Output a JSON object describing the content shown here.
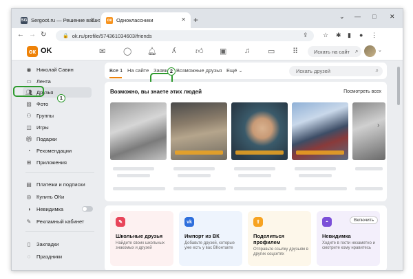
{
  "browser": {
    "tabs": [
      {
        "favicon": "SG",
        "title": "Sergoot.ru — Решение ваших п"
      },
      {
        "favicon": "ok",
        "title": "Одноклассники"
      }
    ],
    "new_tab": "+",
    "window_controls": {
      "minimize": "—",
      "maximize": "□",
      "close": "✕"
    },
    "url": "ok.ru/profile/574361034603/friends"
  },
  "header": {
    "logo_text": "OK",
    "search_placeholder": "Искать на сайт"
  },
  "sidebar": {
    "user_name": "Николай Савин",
    "items": [
      {
        "label": "Лента",
        "icon": "feed-icon"
      },
      {
        "label": "Друзья",
        "icon": "friends-icon"
      },
      {
        "label": "Фото",
        "icon": "photo-icon"
      },
      {
        "label": "Группы",
        "icon": "groups-icon"
      },
      {
        "label": "Игры",
        "icon": "games-icon"
      },
      {
        "label": "Подарки",
        "icon": "gifts-icon"
      },
      {
        "label": "Рекомендации",
        "icon": "recommendations-icon"
      },
      {
        "label": "Приложения",
        "icon": "apps-icon"
      }
    ],
    "extra_items": [
      {
        "label": "Платежи и подписки"
      },
      {
        "label": "Купить ОКи"
      },
      {
        "label": "Невидимка"
      },
      {
        "label": "Рекламный кабинет"
      }
    ],
    "bottom_items": [
      {
        "label": "Закладки"
      },
      {
        "label": "Праздники"
      }
    ]
  },
  "friends": {
    "tabs": [
      {
        "label": "Все",
        "count": "1"
      },
      {
        "label": "На сайте"
      },
      {
        "label": "Заявки"
      },
      {
        "label": "Возможные друзья"
      },
      {
        "label": "Ещё ⌄"
      }
    ],
    "search_placeholder": "Искать друзей"
  },
  "suggestions": {
    "title": "Возможно, вы знаете этих людей",
    "see_all": "Посмотреть всех"
  },
  "promos": [
    {
      "title": "Школьные друзья",
      "desc": "Найдите своих школьных знакомых и друзей",
      "color": "#e8455a",
      "bg": "#fdf1f1"
    },
    {
      "title": "Импорт из ВК",
      "desc": "Добавьте друзей, которые уже есть у вас ВКонтакте",
      "color": "#2f6fdc",
      "bg": "#eef4fd"
    },
    {
      "title": "Поделиться профилем",
      "desc": "Отправьте ссылку друзьям в других соцсетях",
      "color": "#f7a321",
      "bg": "#fdf7ea"
    },
    {
      "title": "Невидимка",
      "desc": "Ходите в гости незаметно и смотрите кому нравитесь",
      "color": "#7b4fd8",
      "bg": "#f3effb",
      "button": "Включить"
    }
  ],
  "annotations": {
    "marker1": "1",
    "marker2": "2",
    "highlight_color": "#2d9a2d"
  },
  "accent_color": "#ee8208"
}
